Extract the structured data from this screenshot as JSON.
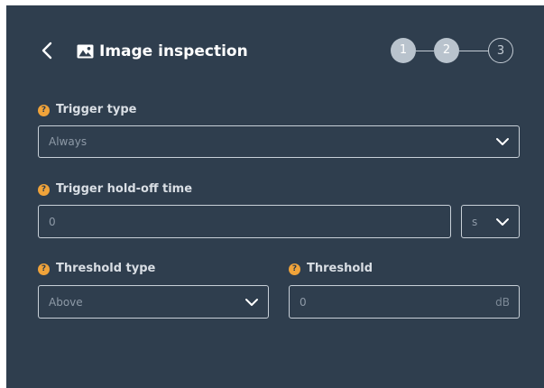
{
  "header": {
    "title": "Image inspection",
    "back_icon": "chevron-left-icon",
    "title_icon": "image-icon",
    "steps": [
      {
        "label": "1",
        "state": "completed"
      },
      {
        "label": "2",
        "state": "completed"
      },
      {
        "label": "3",
        "state": "pending"
      }
    ]
  },
  "form": {
    "trigger_type": {
      "label": "Trigger type",
      "value": "Always"
    },
    "hold_off": {
      "label": "Trigger hold-off time",
      "value": "0",
      "unit": "s"
    },
    "threshold_type": {
      "label": "Threshold type",
      "value": "Above"
    },
    "threshold": {
      "label": "Threshold",
      "value": "0",
      "unit": "dB"
    },
    "help_glyph": "?"
  },
  "colors": {
    "panel_bg": "#2f3e4e",
    "help_badge": "#f0a33a",
    "step_done": "#b9c3cd"
  }
}
